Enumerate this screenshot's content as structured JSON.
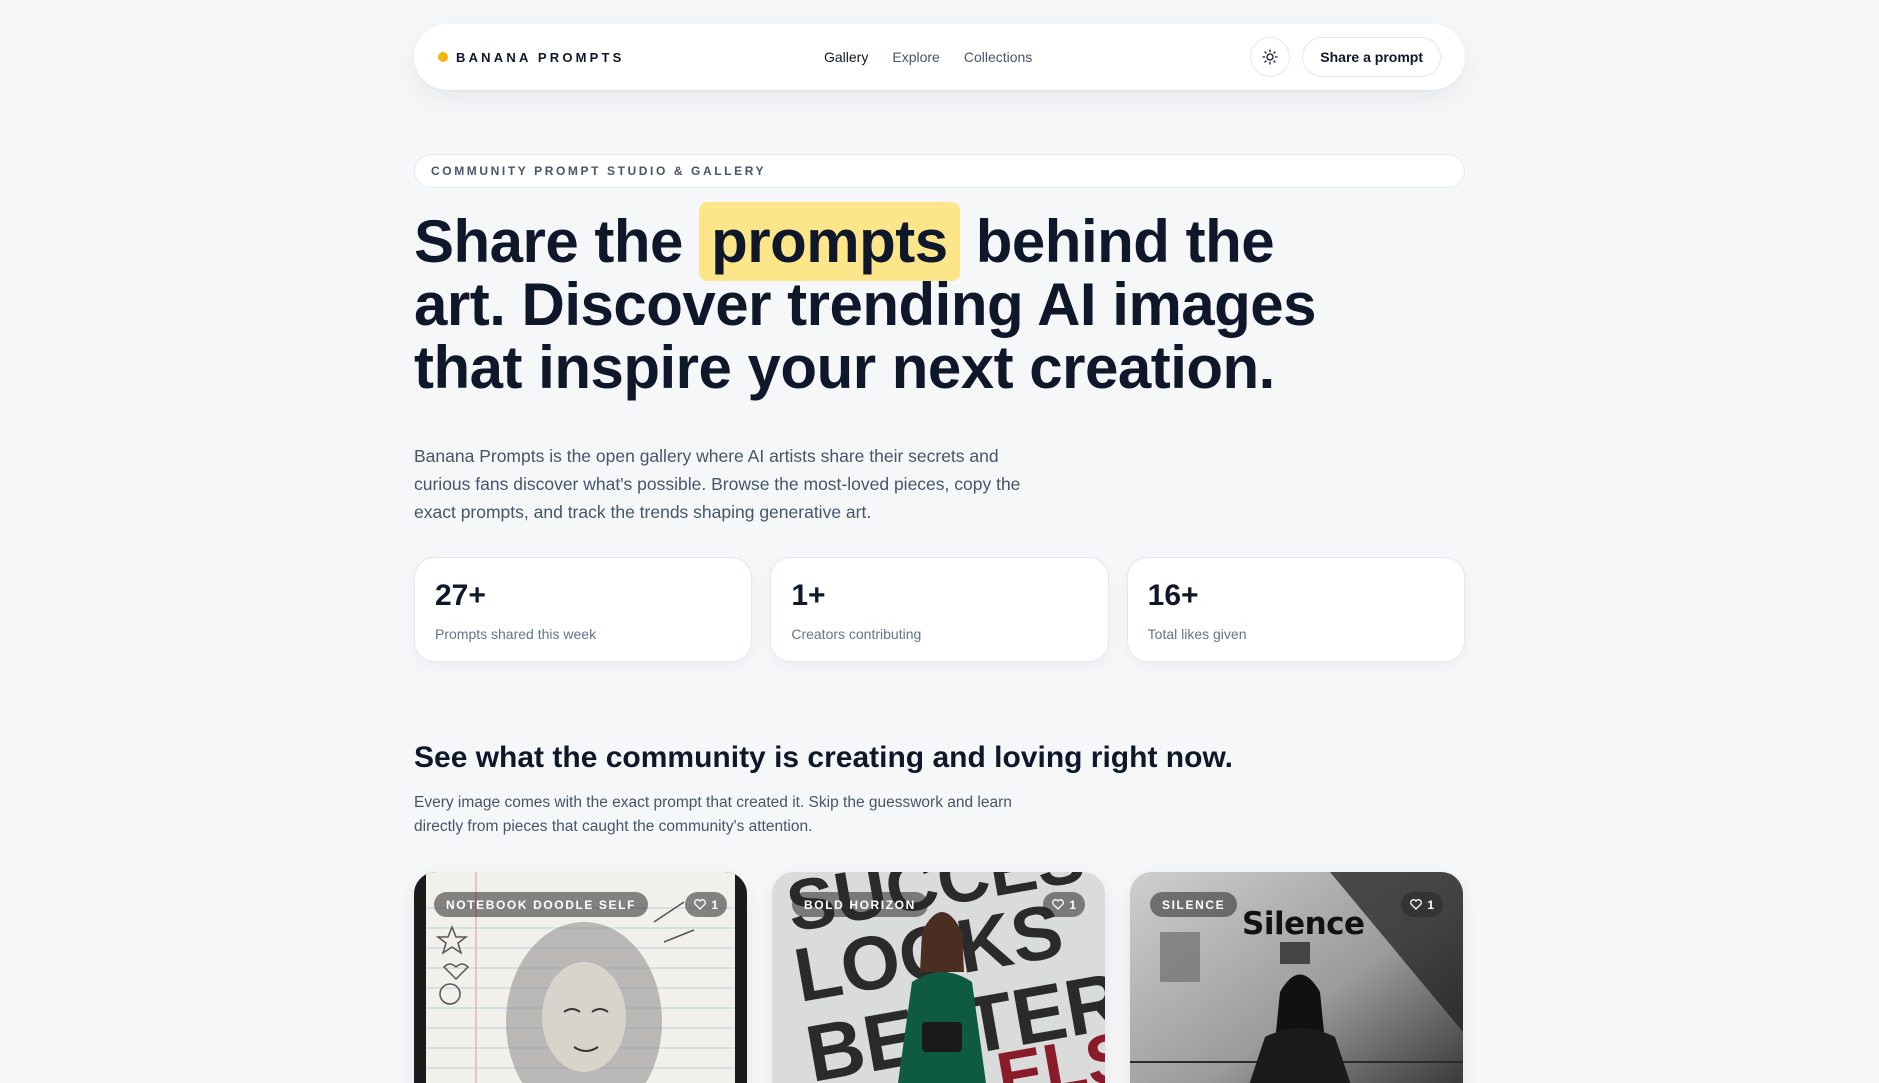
{
  "nav": {
    "brand": "BANANA PROMPTS",
    "links": [
      {
        "label": "Gallery",
        "active": true
      },
      {
        "label": "Explore",
        "active": false
      },
      {
        "label": "Collections",
        "active": false
      }
    ],
    "theme_icon": "sun-icon",
    "share_label": "Share a prompt"
  },
  "eyebrow": "COMMUNITY PROMPT STUDIO & GALLERY",
  "hero": {
    "title_before": "Share the",
    "title_highlight": "prompts",
    "title_after": "behind the art. Discover trending AI images that inspire your next creation.",
    "description": "Banana Prompts is the open gallery where AI artists share their secrets and curious fans discover what's possible. Browse the most-loved pieces, copy the exact prompts, and track the trends shaping generative art."
  },
  "stats": [
    {
      "value": "27+",
      "label": "Prompts shared this week"
    },
    {
      "value": "1+",
      "label": "Creators contributing"
    },
    {
      "value": "16+",
      "label": "Total likes given"
    }
  ],
  "section": {
    "title": "See what the community is creating and loving right now.",
    "description": "Every image comes with the exact prompt that created it. Skip the guesswork and learn directly from pieces that caught the community's attention."
  },
  "cards": [
    {
      "tag": "NOTEBOOK DOODLE SELF",
      "likes": "1",
      "image_overlay_text": ""
    },
    {
      "tag": "BOLD HORIZON",
      "likes": "1",
      "image_overlay_text": ""
    },
    {
      "tag": "SILENCE",
      "likes": "1",
      "image_overlay_text": "Silence"
    }
  ],
  "colors": {
    "accent": "#f5b50b",
    "highlight": "#fde68a",
    "background": "#f6f7f9",
    "text": "#0f172a",
    "muted": "#475569"
  }
}
